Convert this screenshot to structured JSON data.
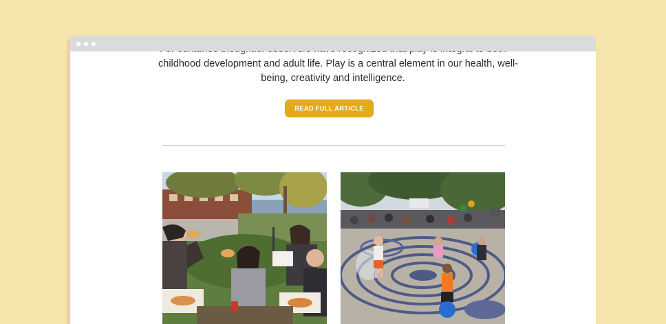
{
  "article": {
    "text_lines": [
      "For centuries thoughtful observers have recognized that play is integral to both",
      "childhood development and adult life. Play is a central element in our health, well-",
      "being, creativity and intelligence."
    ],
    "read_button_label": "READ FULL ARTICLE"
  },
  "colors": {
    "page_background": "#f6e4ad",
    "browser_titlebar": "#dadbdc",
    "button": "#e4aa1c"
  },
  "photos": [
    {
      "icon": "photo-friends-eating-pizza"
    },
    {
      "icon": "photo-children-splash-pad"
    }
  ]
}
